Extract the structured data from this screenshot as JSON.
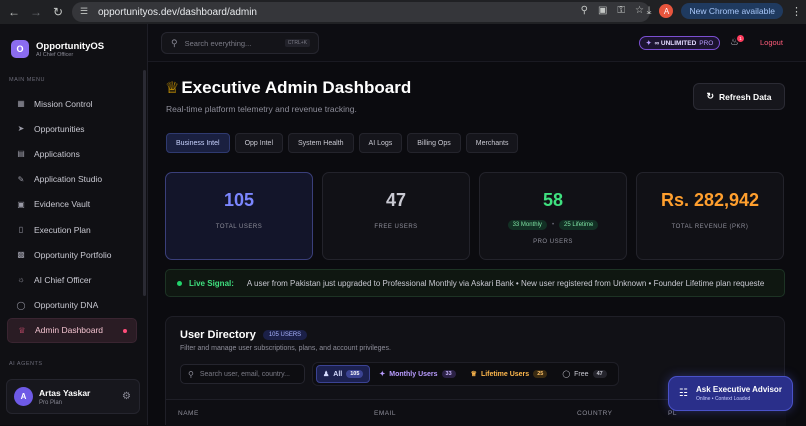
{
  "browser": {
    "url": "opportunityos.dev/dashboard/admin",
    "profile_initial": "A",
    "new_chrome_label": "New Chrome available"
  },
  "sidebar": {
    "brand_title": "OpportunityOS",
    "brand_subtitle": "AI Chief Officer",
    "logo_letter": "O",
    "main_menu_label": "MAIN MENU",
    "items": [
      {
        "label": "Mission Control",
        "icon": "grid-icon"
      },
      {
        "label": "Opportunities",
        "icon": "rocket-icon"
      },
      {
        "label": "Applications",
        "icon": "clipboard-icon"
      },
      {
        "label": "Application Studio",
        "icon": "pen-icon"
      },
      {
        "label": "Evidence Vault",
        "icon": "archive-icon"
      },
      {
        "label": "Execution Plan",
        "icon": "map-icon"
      },
      {
        "label": "Opportunity Portfolio",
        "icon": "briefcase-icon"
      },
      {
        "label": "AI Chief Officer",
        "icon": "lightbulb-icon"
      },
      {
        "label": "Opportunity DNA",
        "icon": "globe-icon"
      },
      {
        "label": "Admin Dashboard",
        "icon": "crown-icon",
        "active": true
      }
    ],
    "ai_agents_label": "AI AGENTS",
    "user": {
      "initial": "A",
      "name": "Artas Yaskar",
      "plan": "Pro Plan"
    }
  },
  "topbar": {
    "search_placeholder": "Search everything...",
    "shortcut": "CTRL+K",
    "plan_badge": "∞ UNLIMITED",
    "plan_tier": "PRO",
    "notification_count": "1",
    "logout_label": "Logout"
  },
  "page": {
    "title": "Executive Admin Dashboard",
    "subtitle": "Real-time platform telemetry and revenue tracking.",
    "refresh_label": "Refresh Data",
    "tabs": [
      "Business Intel",
      "Opp Intel",
      "System Health",
      "AI Logs",
      "Billing Ops",
      "Merchants"
    ],
    "active_tab": "Business Intel"
  },
  "stats": {
    "total_users": {
      "value": "105",
      "label": "TOTAL USERS",
      "color": "#7b86ff"
    },
    "free_users": {
      "value": "47",
      "label": "FREE USERS",
      "color": "#c9c9d2"
    },
    "pro_users": {
      "value": "58",
      "label": "PRO USERS",
      "color": "#3fe07f",
      "monthly": "33 Monthly",
      "lifetime": "25 Lifetime",
      "separator": "•"
    },
    "revenue": {
      "value": "Rs. 282,942",
      "label": "TOTAL REVENUE (PKR)",
      "color": "#ff9f2e"
    }
  },
  "live_signal": {
    "label": "Live Signal:",
    "text": "A user from Pakistan just upgraded to Professional Monthly via Askari Bank • New user registered from Unknown • Founder Lifetime plan requeste"
  },
  "directory": {
    "title": "User Directory",
    "count_badge": "105 USERS",
    "subtitle": "Filter and manage user subscriptions, plans, and account privileges.",
    "search_placeholder": "Search user, email, country...",
    "filters": [
      {
        "label": "All",
        "count": "105"
      },
      {
        "label": "Monthly Users",
        "count": "33"
      },
      {
        "label": "Lifetime Users",
        "count": "25"
      },
      {
        "label": "Free",
        "count": "47"
      }
    ],
    "columns": [
      "NAME",
      "EMAIL",
      "COUNTRY",
      "PL"
    ]
  },
  "advisor": {
    "title": "Ask Executive Advisor",
    "subtitle": "Online • Context Loaded"
  }
}
